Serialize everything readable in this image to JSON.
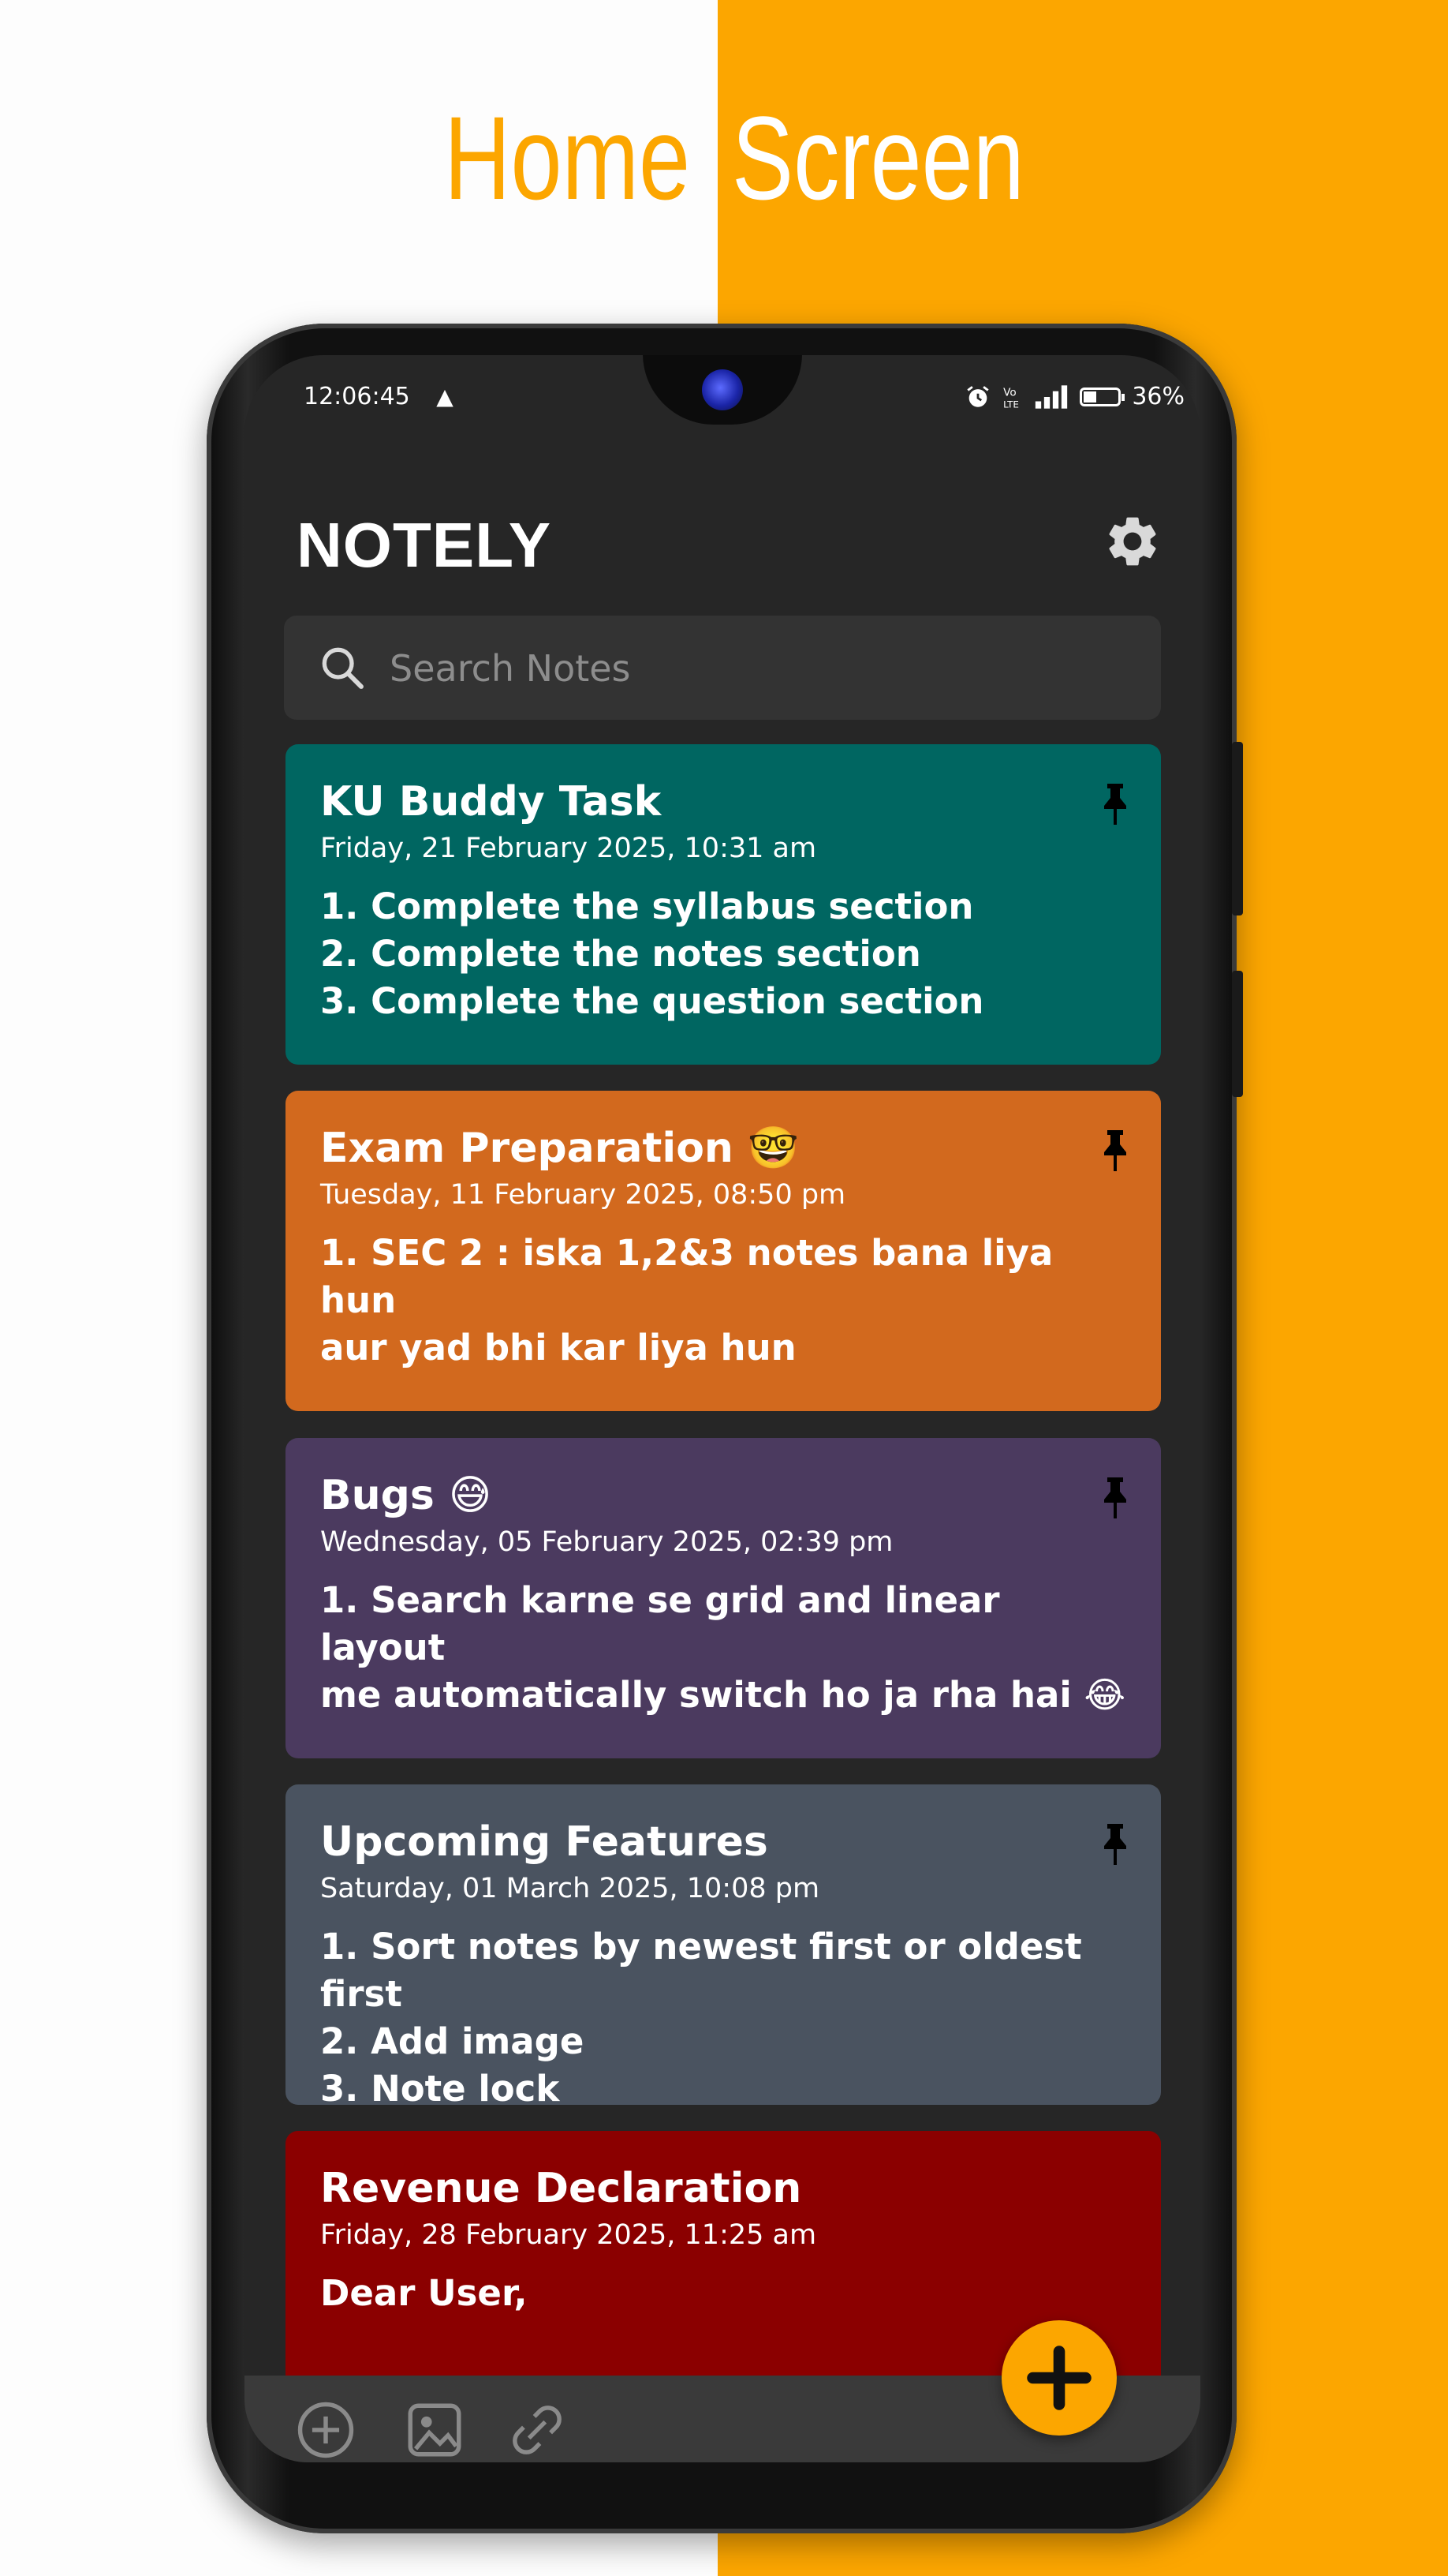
{
  "banner": {
    "title_word1": "Home",
    "title_word2": "Screen"
  },
  "colors": {
    "left_background": "#fdfdfd",
    "right_background": "#fca600",
    "app_background": "#262626",
    "search_background": "#333333",
    "fab": "#fca600"
  },
  "status_bar": {
    "time": "12:06:45",
    "battery": "36%",
    "icons": [
      "warning-icon",
      "alarm-icon",
      "volte-icon",
      "signal-icon",
      "battery-icon"
    ]
  },
  "app": {
    "title": "NOTELY",
    "settings_icon": "gear-icon"
  },
  "search": {
    "placeholder": "Search Notes"
  },
  "notes": [
    {
      "title": "KU Buddy Task",
      "date": "Friday, 21 February 2025, 10:31 am",
      "body": "1. Complete the syllabus section\n2. Complete the notes section\n3. Complete the question section",
      "color": "#006661",
      "pinned": true
    },
    {
      "title": "Exam Preparation 🤓",
      "date": "Tuesday, 11 February 2025, 08:50 pm",
      "body": "1. SEC 2 : iska 1,2&3 notes bana liya hun\naur yad bhi kar liya hun",
      "color": "#d2691e",
      "pinned": true
    },
    {
      "title": "Bugs 😅",
      "date": "Wednesday, 05 February 2025, 02:39 pm",
      "body": "1. Search karne se grid and linear layout\nme automatically switch ho ja rha hai 😂",
      "color": "#4b3a5f",
      "pinned": true
    },
    {
      "title": "Upcoming Features",
      "date": "Saturday, 01 March 2025, 10:08 pm",
      "body": "1. Sort notes by newest first or oldest first\n2. Add image\n3. Note lock",
      "color": "#4a5360",
      "pinned": true
    },
    {
      "title": "Revenue Declaration",
      "date": "Friday, 28 February 2025, 11:25 am",
      "body": "Dear User,",
      "color": "#8b0000",
      "pinned": false
    }
  ],
  "bottom_bar": {
    "icons": [
      "add-circle-icon",
      "image-icon",
      "link-icon"
    ]
  },
  "fab": {
    "icon": "plus-icon"
  }
}
